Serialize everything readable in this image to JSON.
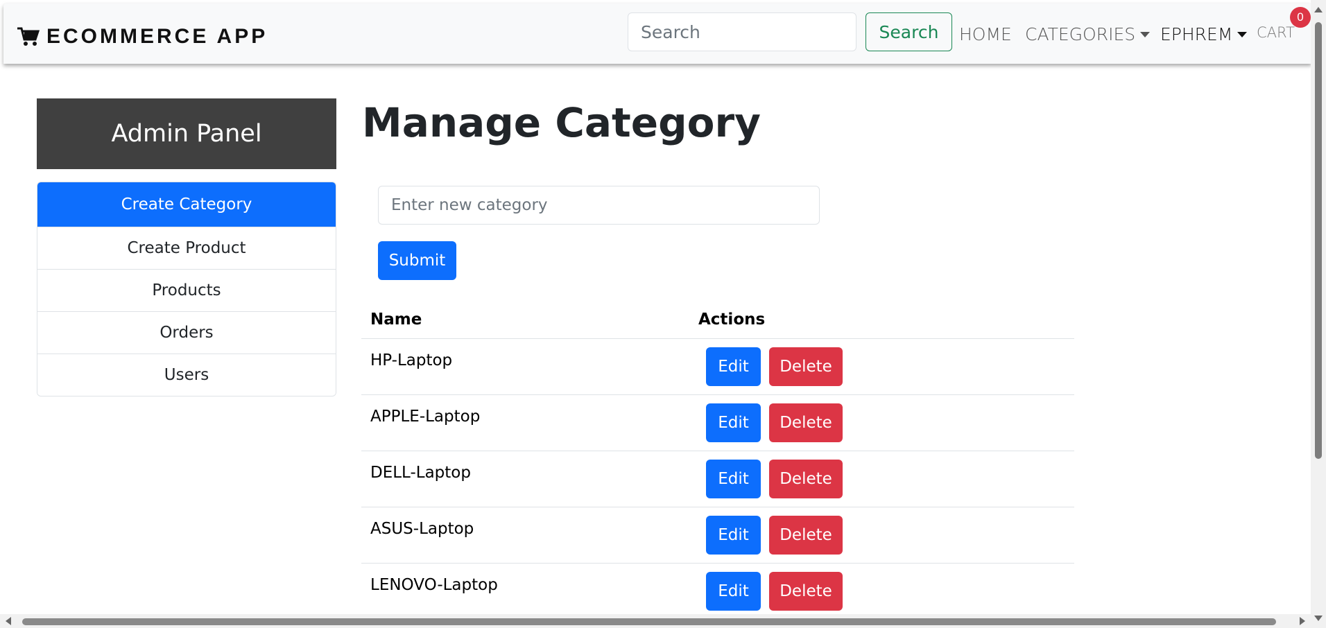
{
  "navbar": {
    "brand": "ECOMMERCE APP",
    "search_placeholder": "Search",
    "search_button": "Search",
    "home": "HOME",
    "categories": "CATEGORIES",
    "user": "EPHREM",
    "cart": "CART",
    "cart_count": "0"
  },
  "sidebar": {
    "title": "Admin Panel",
    "items": [
      {
        "label": "Create Category"
      },
      {
        "label": "Create Product"
      },
      {
        "label": "Products"
      },
      {
        "label": "Orders"
      },
      {
        "label": "Users"
      }
    ]
  },
  "main": {
    "title": "Manage Category",
    "input_placeholder": "Enter new category",
    "submit": "Submit",
    "table": {
      "headers": [
        "Name",
        "Actions"
      ],
      "edit_label": "Edit",
      "delete_label": "Delete",
      "rows": [
        {
          "name": "HP-Laptop"
        },
        {
          "name": "APPLE-Laptop"
        },
        {
          "name": "DELL-Laptop"
        },
        {
          "name": "ASUS-Laptop"
        },
        {
          "name": "LENOVO-Laptop"
        }
      ]
    }
  },
  "colors": {
    "primary": "#0d6efd",
    "danger": "#dc3545",
    "success": "#198754",
    "panel": "#404040"
  }
}
